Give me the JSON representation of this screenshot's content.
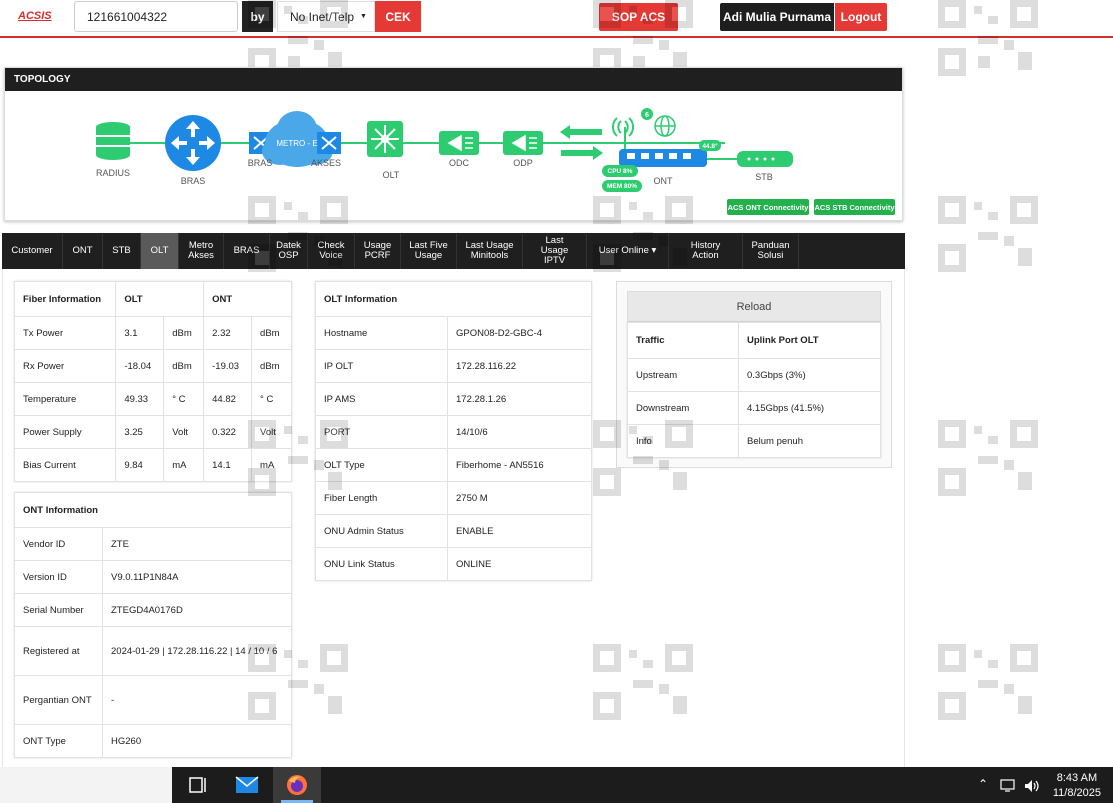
{
  "header": {
    "logo": "ACSIS",
    "search_value": "121661004322",
    "by_label": "by",
    "search_type": "No Inet/Telp",
    "cek_label": "CEK",
    "sop_label": "SOP ACS",
    "user_name": "Adi Mulia Purnama",
    "logout_label": "Logout"
  },
  "topology": {
    "title": "TOPOLOGY",
    "nodes": {
      "radius": "RADIUS",
      "bras": "BRAS",
      "bras2": "BRAS",
      "metro": "METRO - E",
      "akses": "AKSES",
      "olt": "OLT",
      "odc": "ODC",
      "odp": "ODP",
      "ont": "ONT",
      "stb": "STB"
    },
    "ont_badge": "6",
    "temp": "44.8°",
    "cpu": "CPU 8%",
    "mem": "MEM 80%",
    "acs_ont_btn": "ACS ONT Connectivity",
    "acs_stb_btn": "ACS STB Connectivity"
  },
  "tabs": [
    "Customer",
    "ONT",
    "STB",
    "OLT",
    "Metro\nAkses",
    "BRAS",
    "Datek\nOSP",
    "Check\nVoice",
    "Usage\nPCRF",
    "Last Five\nUsage",
    "Last Usage\nMinitools",
    "Last Usage\nIPTV",
    "User Online ▾",
    "History Action",
    "Panduan\nSolusi"
  ],
  "active_tab": "OLT",
  "fiber_info": {
    "headers": [
      "Fiber Information",
      "OLT",
      "ONT"
    ],
    "rows": [
      {
        "label": "Tx Power",
        "olt": "3.1",
        "olt_unit": "dBm",
        "ont": "2.32",
        "ont_unit": "dBm"
      },
      {
        "label": "Rx Power",
        "olt": "-18.04",
        "olt_unit": "dBm",
        "ont": "-19.03",
        "ont_unit": "dBm"
      },
      {
        "label": "Temperature",
        "olt": "49.33",
        "olt_unit": "° C",
        "ont": "44.82",
        "ont_unit": "° C"
      },
      {
        "label": "Power Supply",
        "olt": "3.25",
        "olt_unit": "Volt",
        "ont": "0.322",
        "ont_unit": "Volt"
      },
      {
        "label": "Bias Current",
        "olt": "9.84",
        "olt_unit": "mA",
        "ont": "14.1",
        "ont_unit": "mA"
      }
    ]
  },
  "ont_info": {
    "title": "ONT Information",
    "rows": [
      {
        "label": "Vendor ID",
        "value": "ZTE"
      },
      {
        "label": "Version ID",
        "value": "V9.0.11P1N84A"
      },
      {
        "label": "Serial Number",
        "value": "ZTEGD4A0176D"
      },
      {
        "label": "Registered at",
        "value": "2024-01-29 | 172.28.116.22 | 14 / 10 / 6"
      },
      {
        "label": "Pergantian ONT",
        "value": "-"
      },
      {
        "label": "ONT Type",
        "value": "HG260"
      }
    ]
  },
  "olt_info": {
    "title": "OLT Information",
    "rows": [
      {
        "label": "Hostname",
        "value": "GPON08-D2-GBC-4"
      },
      {
        "label": "IP OLT",
        "value": "172.28.116.22"
      },
      {
        "label": "IP AMS",
        "value": "172.28.1.26"
      },
      {
        "label": "PORT",
        "value": "14/10/6"
      },
      {
        "label": "OLT Type",
        "value": "Fiberhome - AN5516"
      },
      {
        "label": "Fiber Length",
        "value": "2750 M"
      },
      {
        "label": "ONU Admin Status",
        "value": "ENABLE"
      },
      {
        "label": "ONU Link Status",
        "value": "ONLINE"
      }
    ]
  },
  "traffic": {
    "reload_label": "Reload",
    "headers": [
      "Traffic",
      "Uplink Port OLT"
    ],
    "rows": [
      {
        "label": "Upstream",
        "value": "0.3Gbps (3%)"
      },
      {
        "label": "Downstream",
        "value": "4.15Gbps (41.5%)"
      },
      {
        "label": "Info",
        "value": "Belum penuh"
      }
    ]
  },
  "taskbar": {
    "time": "8:43 AM",
    "date": "11/8/2025"
  }
}
